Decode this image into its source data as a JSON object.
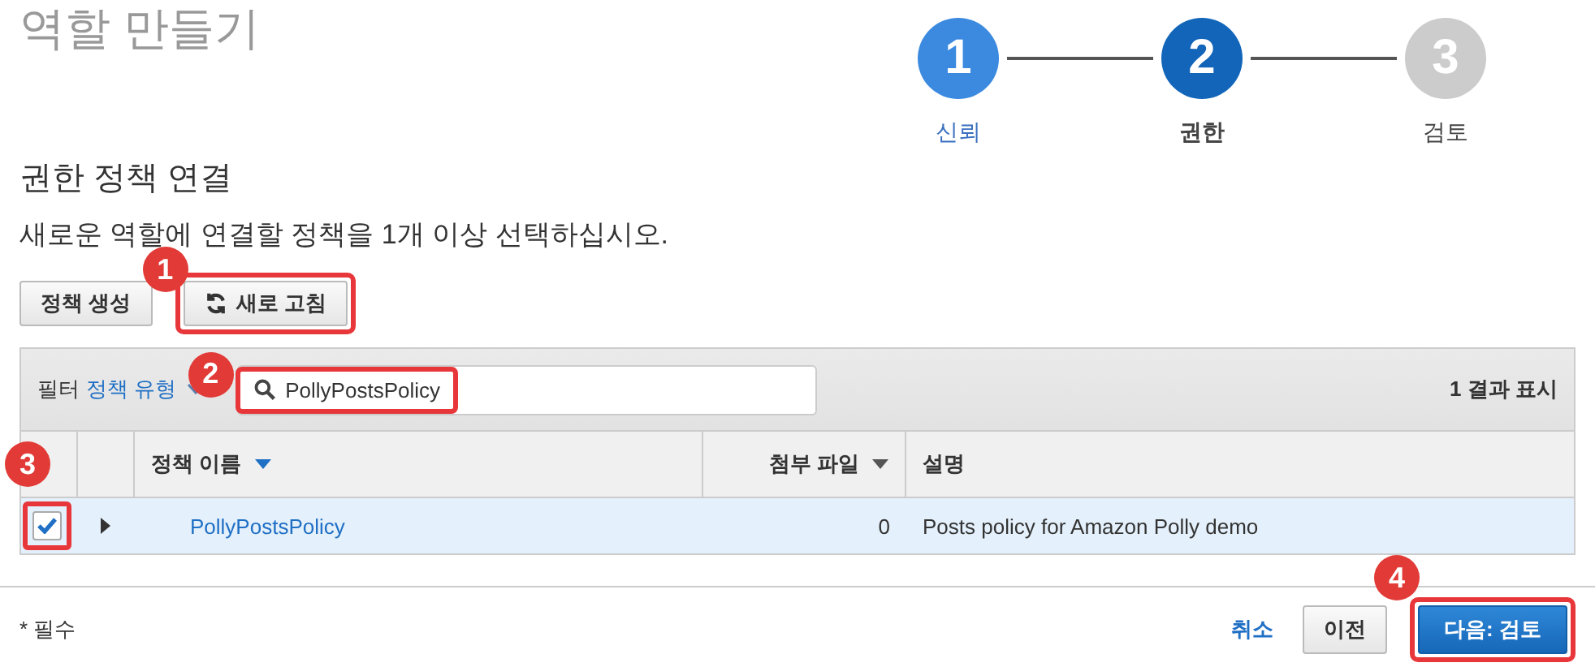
{
  "page_title": "역할 만들기",
  "steps": [
    {
      "number": "1",
      "label": "신뢰",
      "done": true,
      "current": false
    },
    {
      "number": "2",
      "label": "권한",
      "done": false,
      "current": true
    },
    {
      "number": "3",
      "label": "검토",
      "done": false,
      "current": false
    }
  ],
  "section_title": "권한 정책 연결",
  "description": "새로운 역할에 연결할 정책을 1개 이상 선택하십시오.",
  "toolbar": [
    {
      "kind": "plain",
      "label": "정책 생성"
    },
    {
      "kind": "refresh",
      "label": "새로 고침",
      "callout": "1"
    }
  ],
  "filter": {
    "label": "필터",
    "type_link": "정책 유형",
    "search_value": "PollyPostsPolicy",
    "callout": "2",
    "result_count": "1 결과 표시"
  },
  "table": {
    "columns": [
      {
        "label": "정책 이름",
        "sortable": true,
        "sorted": true
      },
      {
        "label": "첨부 파일",
        "sortable": true,
        "sorted": false
      },
      {
        "label": "설명",
        "sortable": false
      }
    ],
    "rows": [
      {
        "checked": true,
        "selected": true,
        "callout": "3",
        "name": "PollyPostsPolicy",
        "attachments": "0",
        "description": "Posts policy for Amazon Polly demo"
      }
    ]
  },
  "footer": {
    "required_note": "* 필수",
    "cancel": "취소",
    "previous": "이전",
    "next": "다음: 검토",
    "next_callout": "4"
  }
}
